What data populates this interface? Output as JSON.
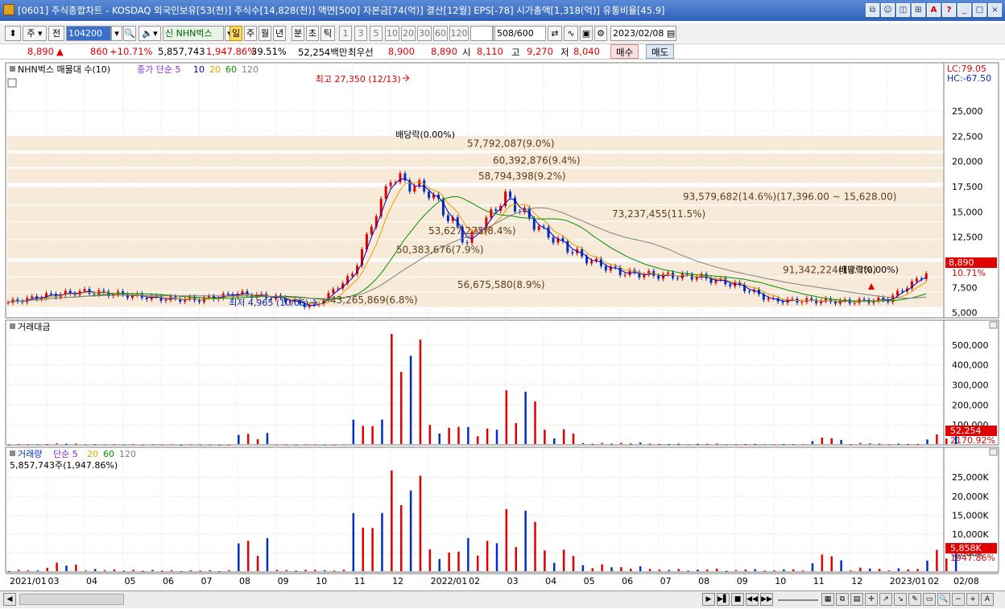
{
  "window": {
    "title": "[0601] 주식종합차트 - KOSDAQ 외국인보유[53(천)] 주식수[14,828(천)] 액면[500] 자본금[74(억)] 결산[12월] EPS[-78] 시가총액[1,318(억)] 유통비율[45.9]",
    "window_buttons": [
      "⧉",
      "☺",
      "◫",
      "⊞",
      "A",
      "?",
      "_",
      "□",
      "×"
    ]
  },
  "toolbar": {
    "period_type": "주",
    "prev_label": "전",
    "code": "104200",
    "stock_badge": "신",
    "stock_name": "NHN벅스",
    "period_tabs": [
      "일",
      "주",
      "월",
      "년",
      "분",
      "초",
      "틱"
    ],
    "active_period": "일",
    "intervals": [
      "1",
      "3",
      "5",
      "10",
      "20",
      "30",
      "60",
      "120"
    ],
    "count": "508",
    "count_total": "/600",
    "date": "2023/02/08"
  },
  "quote": {
    "price": "8,890",
    "arrow": "▲",
    "change": "860",
    "change_pct": "+10.71%",
    "volume": "5,857,743",
    "volume_ratio": "1,947.86%",
    "turnover": "39.51%",
    "amount": "52,254백만",
    "best_label": "최우선",
    "best_ask": "8,900",
    "best_bid": "8,890",
    "open_label": "시",
    "open": "8,110",
    "high_label": "고",
    "high": "9,270",
    "low_label": "저",
    "low": "8,040",
    "buy_label": "매수",
    "sell_label": "매도"
  },
  "price_panel": {
    "legend_main": "NHN벅스 매물대 수(10)",
    "legend_ma": "종가 단순 5",
    "ma_labels": [
      "10",
      "20",
      "60",
      "120"
    ],
    "lc": "LC:79.05",
    "hc": "HC:-67.50",
    "price_tag": "8,890",
    "pct_tag": "10.71%",
    "high_note": "최고 27,350 (12/13)",
    "low_note": "최저 4,965 (10/06)",
    "dividend_notes": [
      "배당락(0.00%)",
      "배당락(0.00%)"
    ]
  },
  "amount_panel": {
    "legend": "거래대금",
    "value_tag": "52,254",
    "pct_tag": "2170.92%"
  },
  "volume_panel": {
    "legend": "거래량",
    "legend_ma": "단순 5",
    "ma_labels": [
      "20",
      "60",
      "120"
    ],
    "info": "5,857,743주(1,947.86%)",
    "value_tag": "5,858K",
    "pct_tag": "1947.86%"
  },
  "x_axis": {
    "labels": [
      "2021/01",
      "03",
      "04",
      "05",
      "06",
      "07",
      "08",
      "09",
      "10",
      "11",
      "12",
      "2022/01",
      "02",
      "03",
      "04",
      "05",
      "06",
      "07",
      "08",
      "09",
      "10",
      "11",
      "12",
      "2023/01",
      "02"
    ],
    "right_label": "02/08"
  },
  "scrollbar": {
    "buttons": [
      "◀",
      "▶",
      "▶▌",
      "■",
      "◀◀",
      "▶▶",
      "−",
      "+",
      "A"
    ]
  },
  "colors": {
    "up": "#e00000",
    "down": "#0030c0",
    "ma5": "#8a2be2",
    "ma10": "#0000cc",
    "ma20": "#e0a000",
    "ma60": "#009000",
    "ma120": "#808080",
    "volume_profile": "#f7e6d2"
  },
  "chart_data": [
    {
      "type": "line",
      "title": "NHN벅스",
      "y_ticks": [
        "25,000",
        "22,500",
        "20,000",
        "17,500",
        "15,000",
        "12,500",
        "10,000",
        "7,500",
        "5,000"
      ],
      "ylim": [
        4500,
        28500
      ],
      "grid": true,
      "x_months": [
        "2021/01",
        "03",
        "04",
        "05",
        "06",
        "07",
        "08",
        "09",
        "10",
        "11",
        "12",
        "2022/01",
        "02",
        "03",
        "04",
        "05",
        "06",
        "07",
        "08",
        "09",
        "10",
        "11",
        "12",
        "2023/01",
        "02"
      ],
      "series": [
        {
          "name": "종가",
          "values": [
            6000,
            6700,
            7100,
            6800,
            6400,
            6300,
            6900,
            6500,
            5600,
            8800,
            18500,
            17000,
            12000,
            16500,
            13000,
            10500,
            9000,
            8700,
            8600,
            7800,
            6200,
            6200,
            6100,
            6300,
            8890
          ]
        }
      ],
      "volume_profile": [
        {
          "price_range": [
            17396,
            15628
          ],
          "amount": "93,579,682",
          "pct": "14.6%"
        },
        {
          "price_range": [
            22500,
            21000
          ],
          "amount": "57,792,087",
          "pct": "9.0%"
        },
        {
          "price_range": [
            20800,
            19400
          ],
          "amount": "60,392,876",
          "pct": "9.4%"
        },
        {
          "price_range": [
            19300,
            17800
          ],
          "amount": "58,794,398",
          "pct": "9.2%"
        },
        {
          "price_range": [
            15600,
            14000
          ],
          "amount": "73,237,455",
          "pct": "11.5%"
        },
        {
          "price_range": [
            14000,
            12200
          ],
          "amount": "53,627,275",
          "pct": "8.4%"
        },
        {
          "price_range": [
            12200,
            10300
          ],
          "amount": "50,383,676",
          "pct": "7.9%"
        },
        {
          "price_range": [
            10000,
            8500
          ],
          "amount": "91,342,224",
          "pct": "14.3%"
        },
        {
          "price_range": [
            8500,
            7000
          ],
          "amount": "56,675,580",
          "pct": "8.9%"
        },
        {
          "price_range": [
            7000,
            5500
          ],
          "amount": "43,265,869",
          "pct": "6.8%"
        }
      ],
      "high": {
        "value": "27,350",
        "date": "12/13"
      },
      "low": {
        "value": "4,965",
        "date": "10/06"
      }
    },
    {
      "type": "bar",
      "title": "거래대금",
      "y_ticks": [
        "500,000",
        "400,000",
        "300,000",
        "200,000",
        "100,000"
      ],
      "ylim": [
        0,
        560000
      ],
      "x_months": [
        "2021/01",
        "03",
        "04",
        "05",
        "06",
        "07",
        "08",
        "09",
        "10",
        "11",
        "12",
        "2022/01",
        "02",
        "03",
        "04",
        "05",
        "06",
        "07",
        "08",
        "09",
        "10",
        "11",
        "12",
        "2023/01",
        "02"
      ],
      "values": [
        4000,
        8000,
        3000,
        2500,
        2000,
        1500,
        60000,
        2000,
        2000,
        130000,
        560000,
        100000,
        90000,
        280000,
        80000,
        10000,
        12000,
        6000,
        7000,
        5000,
        4000,
        40000,
        10000,
        6000,
        52254
      ]
    },
    {
      "type": "bar",
      "title": "거래량",
      "y_ticks": [
        "25,000K",
        "20,000K",
        "15,000K",
        "10,000K",
        "5,000K"
      ],
      "ylim": [
        0,
        29500
      ],
      "x_months": [
        "2021/01",
        "03",
        "04",
        "05",
        "06",
        "07",
        "08",
        "09",
        "10",
        "11",
        "12",
        "2022/01",
        "02",
        "03",
        "04",
        "05",
        "06",
        "07",
        "08",
        "09",
        "10",
        "11",
        "12",
        "2023/01",
        "02"
      ],
      "values": [
        600,
        2500,
        800,
        600,
        500,
        500,
        9000,
        600,
        600,
        16000,
        27000,
        6000,
        9000,
        17000,
        6000,
        2000,
        1500,
        800,
        900,
        800,
        800,
        5000,
        1200,
        1000,
        5858
      ]
    }
  ]
}
